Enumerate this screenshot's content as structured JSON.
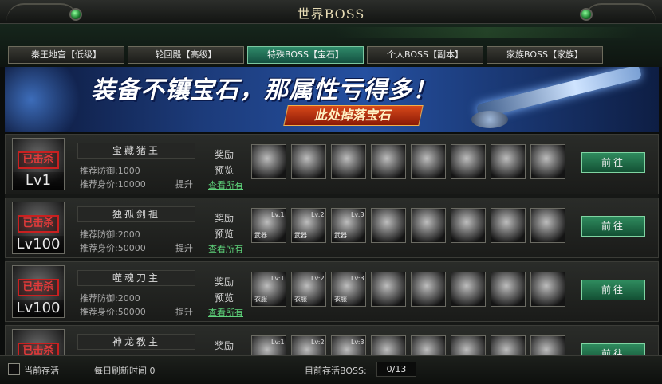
{
  "window": {
    "title": "世界BOSS"
  },
  "tabs": [
    {
      "label": "秦王地宫【低级】"
    },
    {
      "label": "轮回殿【高级】"
    },
    {
      "label": "特殊BOSS【宝石】"
    },
    {
      "label": "个人BOSS【副本】"
    },
    {
      "label": "家族BOSS【家族】"
    }
  ],
  "active_tab": "特殊BOSS【宝石】",
  "banner": {
    "headline": "装备不镶宝石，那属性亏得多！",
    "subline": "此处掉落宝石"
  },
  "row_labels": {
    "killed_stamp": "已击杀",
    "reward_line1": "奖励",
    "reward_line2": "预览",
    "view_all": "查看所有",
    "promote": "提升",
    "go_button": "前往"
  },
  "bosses": [
    {
      "name": "宝藏猪王",
      "level": "Lv1",
      "defense": "推荐防御:1000",
      "worth": "推荐身价:10000",
      "items": [
        {
          "icon": "silver-ingot-icon",
          "lv": "",
          "type": ""
        },
        {
          "icon": "ore-stone-icon",
          "lv": "",
          "type": ""
        },
        {
          "icon": "swirl-stone-icon",
          "lv": "",
          "type": ""
        },
        {
          "icon": "taiji-scroll-icon",
          "lv": "",
          "type": ""
        },
        {
          "icon": "ore-shards-icon",
          "lv": "",
          "type": ""
        },
        {
          "icon": "crystal-icon",
          "lv": "",
          "type": ""
        },
        {
          "icon": "gem-icon",
          "lv": "",
          "type": ""
        },
        {
          "icon": "rune-gem-icon",
          "lv": "",
          "type": ""
        }
      ]
    },
    {
      "name": "独孤剑祖",
      "level": "Lv100",
      "defense": "推荐防御:2000",
      "worth": "推荐身价:50000",
      "items": [
        {
          "icon": "weapon-box-icon",
          "lv": "Lv:1",
          "type": "武器"
        },
        {
          "icon": "weapon-box-icon",
          "lv": "Lv:2",
          "type": "武器"
        },
        {
          "icon": "weapon-box-icon",
          "lv": "Lv:3",
          "type": "武器"
        },
        {
          "icon": "coin-icon",
          "lv": "",
          "type": ""
        },
        {
          "icon": "bowl-icon",
          "lv": "",
          "type": ""
        },
        {
          "icon": "ore-shards-icon",
          "lv": "",
          "type": ""
        },
        {
          "icon": "crystal-icon",
          "lv": "",
          "type": ""
        },
        {
          "icon": "gem-icon",
          "lv": "",
          "type": ""
        }
      ]
    },
    {
      "name": "噬魂刀主",
      "level": "Lv100",
      "defense": "推荐防御:2000",
      "worth": "推荐身价:50000",
      "items": [
        {
          "icon": "armor-box-icon",
          "lv": "Lv:1",
          "type": "衣服"
        },
        {
          "icon": "armor-box-icon",
          "lv": "Lv:2",
          "type": "衣服"
        },
        {
          "icon": "armor-box-icon",
          "lv": "Lv:3",
          "type": "衣服"
        },
        {
          "icon": "coin-icon",
          "lv": "",
          "type": ""
        },
        {
          "icon": "bowl-icon",
          "lv": "",
          "type": ""
        },
        {
          "icon": "ore-shards-icon",
          "lv": "",
          "type": ""
        },
        {
          "icon": "crystal-icon",
          "lv": "",
          "type": ""
        },
        {
          "icon": "gem-icon",
          "lv": "",
          "type": ""
        }
      ]
    },
    {
      "name": "神龙教主",
      "level": "",
      "defense": "",
      "worth": "",
      "items": [
        {
          "icon": "helmet-box-icon",
          "lv": "Lv:1",
          "type": ""
        },
        {
          "icon": "helmet-box-icon",
          "lv": "Lv:2",
          "type": ""
        },
        {
          "icon": "helmet-box-icon",
          "lv": "Lv:3",
          "type": ""
        },
        {
          "icon": "coin-icon",
          "lv": "",
          "type": ""
        },
        {
          "icon": "bowl-icon",
          "lv": "",
          "type": ""
        },
        {
          "icon": "ore-shards-icon",
          "lv": "",
          "type": ""
        },
        {
          "icon": "crystal-icon",
          "lv": "",
          "type": ""
        },
        {
          "icon": "gem-icon",
          "lv": "",
          "type": ""
        }
      ]
    }
  ],
  "footer": {
    "current_alive_label": "当前存活",
    "refresh_label": "每日刷新时间 0",
    "alive_boss_label": "目前存活BOSS:",
    "alive_count": "0/13"
  }
}
